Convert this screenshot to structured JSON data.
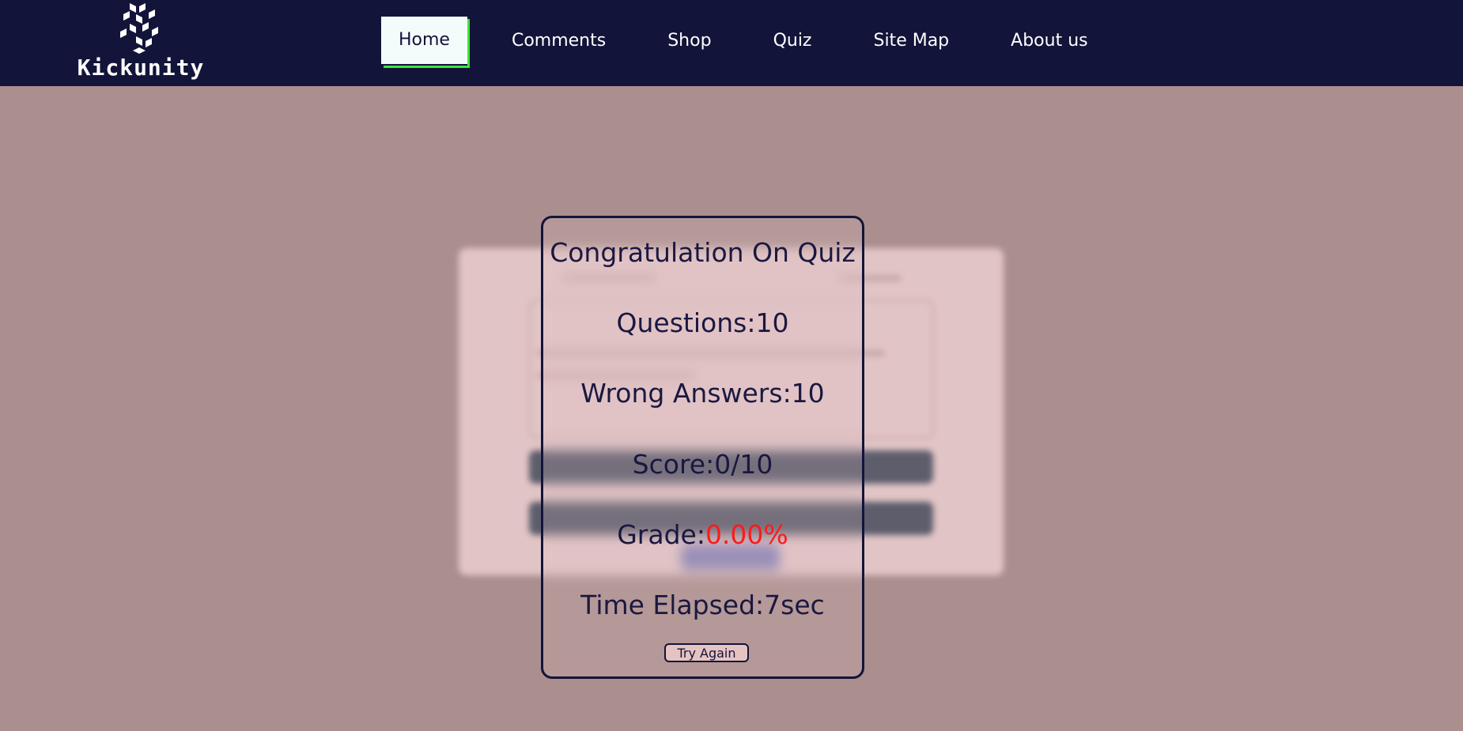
{
  "header": {
    "logo_text": "Kickunity",
    "nav": [
      {
        "label": "Home",
        "active": true
      },
      {
        "label": "Comments"
      },
      {
        "label": "Shop"
      },
      {
        "label": "Quiz"
      },
      {
        "label": "Site Map"
      },
      {
        "label": "About us"
      }
    ],
    "colors": {
      "background": "#13143a",
      "active_bg": "#f3fbfb",
      "active_accent": "#39e83a"
    }
  },
  "result": {
    "title": "Congratulation On Quiz",
    "questions": "Questions:10",
    "wrong": "Wrong Answers:10",
    "score": "Score:0/10",
    "grade_label": "Grade:",
    "grade_value": "0.00%",
    "time": "Time Elapsed:7sec",
    "try_again": "Try Again",
    "colors": {
      "grade_value": "#ff1a1a",
      "page_background": "#ab8f8e"
    }
  }
}
